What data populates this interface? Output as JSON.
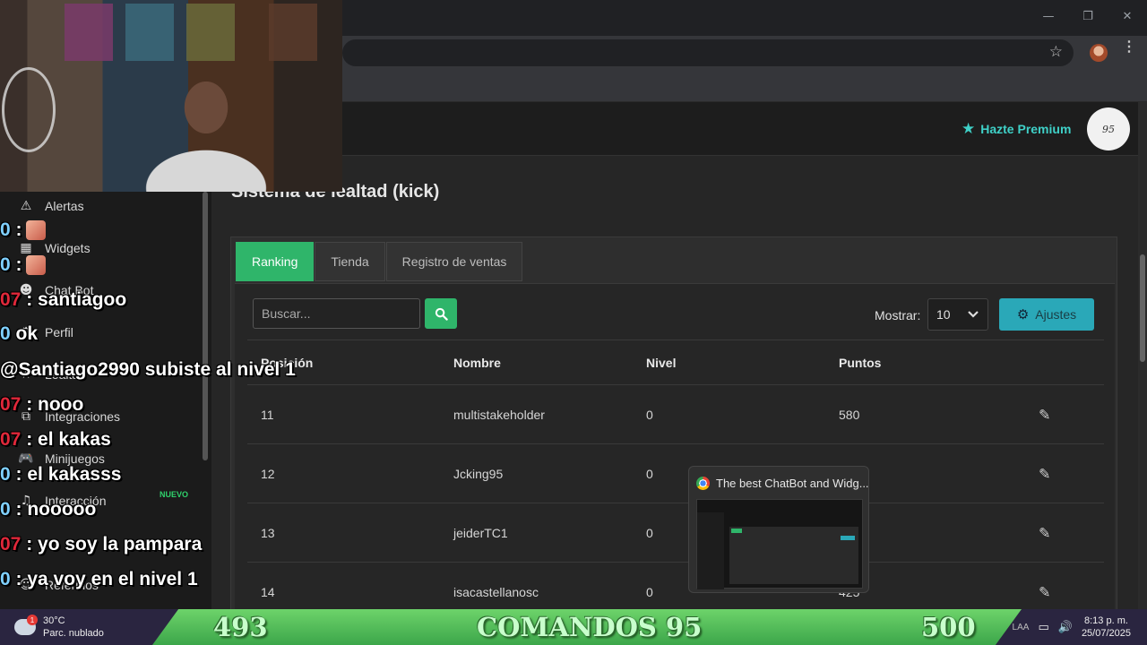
{
  "browser": {
    "window_controls": {
      "minimize": "—",
      "maximize": "❐",
      "close": "✕"
    },
    "star_icon": "☆",
    "menu_icon": "⋮"
  },
  "header": {
    "premium_label": "Hazte Premium",
    "avatar_text": "95"
  },
  "page": {
    "title": "Sistema de lealtad (kick)"
  },
  "tabs": [
    {
      "label": "Ranking",
      "active": true
    },
    {
      "label": "Tienda"
    },
    {
      "label": "Registro de ventas"
    }
  ],
  "toolbar": {
    "search_placeholder": "Buscar...",
    "mostrar_label": "Mostrar:",
    "mostrar_value": "10",
    "ajustes_label": "Ajustes"
  },
  "table": {
    "columns": [
      "Posición",
      "Nombre",
      "Nivel",
      "Puntos"
    ],
    "rows": [
      {
        "pos": "11",
        "name": "multistakeholder",
        "level": "0",
        "points": "580"
      },
      {
        "pos": "12",
        "name": "Jcking95",
        "level": "0",
        "points": ""
      },
      {
        "pos": "13",
        "name": "jeiderTC1",
        "level": "0",
        "points": ""
      },
      {
        "pos": "14",
        "name": "isacastellanosc",
        "level": "0",
        "points": "425"
      }
    ],
    "edit_icon": "✎"
  },
  "sidebar": {
    "items": [
      {
        "label": "Alertas",
        "icon": "⚠"
      },
      {
        "label": "Widgets",
        "icon": "▦"
      },
      {
        "label": "Chat Bot",
        "icon": "☻"
      },
      {
        "label": "Perfil",
        "icon": "⚙"
      },
      {
        "label": "Lealtad",
        "icon": "★"
      },
      {
        "label": "Integraciones",
        "icon": "⧉"
      },
      {
        "label": "Minijuegos",
        "icon": "🎮"
      },
      {
        "label": "Interacción",
        "icon": "♫"
      },
      {
        "label": "Referidos",
        "icon": "☺"
      }
    ],
    "nuevo_badge": "NUEVO"
  },
  "chat": [
    {
      "prefix": "0",
      "text": " :",
      "emote": true
    },
    {
      "prefix": "0",
      "text": " :",
      "emote": true
    },
    {
      "prefix": "07",
      "text": " : santiagoo"
    },
    {
      "prefix": "0",
      "text": " ok"
    },
    {
      "prefix": "",
      "text": "@Santiago2990 subiste al nivel 1"
    },
    {
      "prefix": "07",
      "text": " : nooo"
    },
    {
      "prefix": "07",
      "text": " : el kakas"
    },
    {
      "prefix": "0",
      "text": " : el kakasss"
    },
    {
      "prefix": "0",
      "text": " : nooooo"
    },
    {
      "prefix": "07",
      "text": " : yo soy la pampara"
    },
    {
      "prefix": "0",
      "text": " : ya voy en el nivel 1"
    }
  ],
  "preview": {
    "title": "The best ChatBot and Widg..."
  },
  "taskbar": {
    "weather_temp": "30°C",
    "weather_desc": "Parc. nublado",
    "weather_badge": "1",
    "lang": "LAA",
    "time": "8:13 p. m.",
    "date": "25/07/2025"
  },
  "banner": {
    "left": "493",
    "center": "COMANDOS 95",
    "right": "500"
  },
  "colors": {
    "accent_green": "#2fb56a",
    "accent_teal": "#3fd1c8",
    "button_blue": "#2aa8b8"
  }
}
